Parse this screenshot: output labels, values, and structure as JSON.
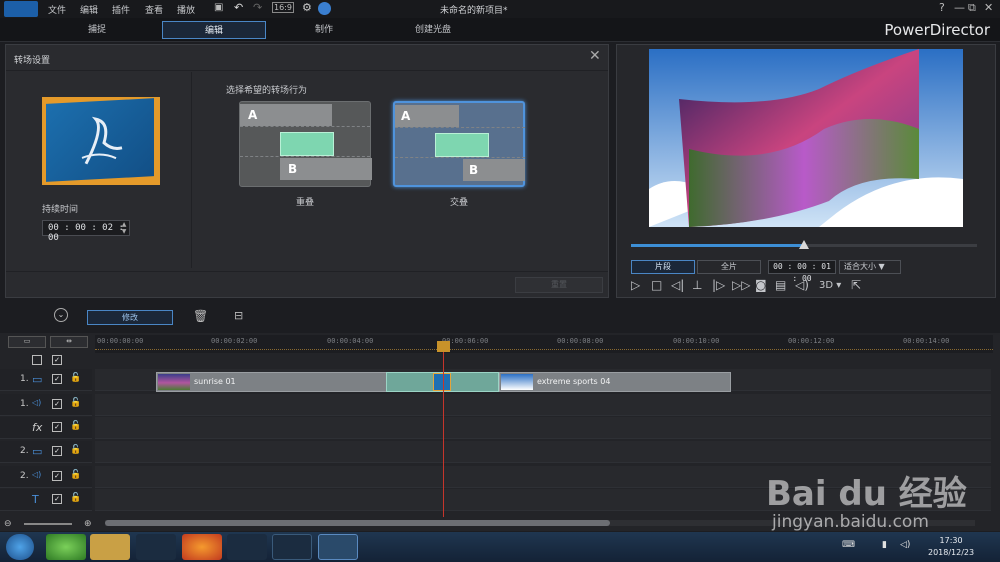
{
  "menubar": {
    "items": [
      "文件",
      "编辑",
      "插件",
      "查看",
      "播放"
    ],
    "title": "未命名的新项目*",
    "window_buttons": [
      "?",
      "—",
      "⧉",
      "✕"
    ]
  },
  "modes": {
    "tabs": [
      "捕捉",
      "编辑",
      "制作",
      "创建光盘"
    ],
    "brand": "PowerDirector"
  },
  "transition_panel": {
    "title": "转场设置",
    "duration_label": "持续时间",
    "duration_value": "00 : 00 : 02 : 00",
    "choose_label": "选择希望的转场行为",
    "card_overlap_label": "重叠",
    "card_cross_label": "交叠",
    "label_a": "A",
    "label_b": "B",
    "reset_label": "重置"
  },
  "preview": {
    "clip_button": "片段",
    "movie_button": "全片",
    "timecode": "00 : 00 : 01 : 00",
    "fit_label": "适合大小",
    "mode_3d": "3D",
    "progress": 0.5
  },
  "toolbar": {
    "modify_label": "修改"
  },
  "timeline": {
    "ticks": [
      "00:00:00:00",
      "00:00:02:00",
      "00:00:04:00",
      "00:00:06:00",
      "00:00:08:00",
      "00:00:10:00",
      "00:00:12:00",
      "00:00:14:00"
    ],
    "tracks": [
      {
        "num": "1.",
        "icon": "video-track-icon",
        "glyph": "▭"
      },
      {
        "num": "1.",
        "icon": "audio-track-icon",
        "glyph": "◁)"
      },
      {
        "num": "",
        "icon": "fx-track-icon",
        "glyph": "fx"
      },
      {
        "num": "2.",
        "icon": "video-track-icon",
        "glyph": "▭"
      },
      {
        "num": "2.",
        "icon": "audio-track-icon",
        "glyph": "◁)"
      },
      {
        "num": "",
        "icon": "title-track-icon",
        "glyph": "T"
      }
    ],
    "clip1_name": "sunrise 01",
    "clip2_name": "extreme sports 04"
  },
  "taskbar": {
    "time": "17:30",
    "date": "2018/12/23"
  },
  "watermark": {
    "line1": "Bai du 经验",
    "line2": "jingyan.baidu.com"
  }
}
